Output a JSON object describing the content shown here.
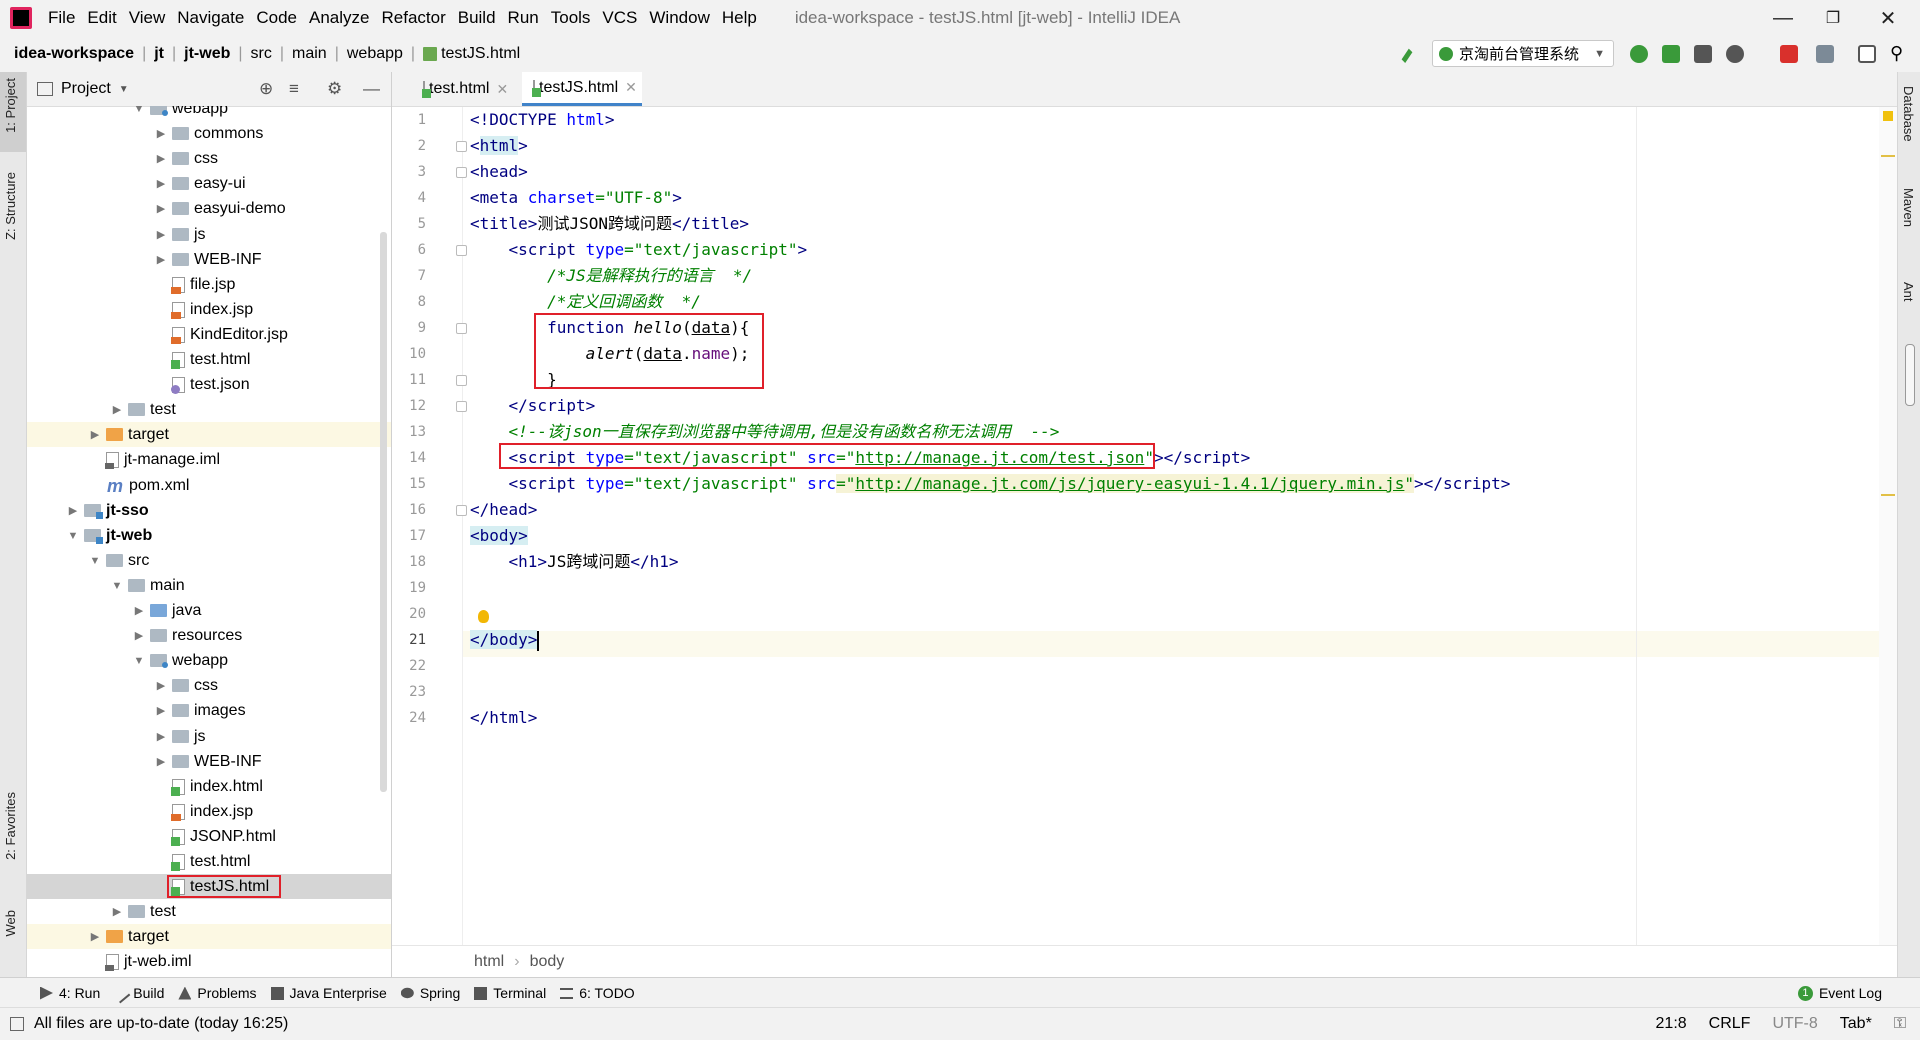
{
  "menubar": {
    "items": [
      "File",
      "Edit",
      "View",
      "Navigate",
      "Code",
      "Analyze",
      "Refactor",
      "Build",
      "Run",
      "Tools",
      "VCS",
      "Window",
      "Help"
    ],
    "window_title": "idea-workspace - testJS.html [jt-web] - IntelliJ IDEA"
  },
  "navbar": {
    "crumbs": [
      "idea-workspace",
      "jt",
      "jt-web",
      "src",
      "main",
      "webapp",
      "testJS.html"
    ],
    "run_config": "京淘前台管理系统"
  },
  "left_stripe": {
    "project": "1: Project",
    "structure": "Z: Structure",
    "favorites": "2: Favorites",
    "web": "Web"
  },
  "right_stripe": {
    "database": "Database",
    "maven": "Maven",
    "ant": "Ant"
  },
  "project_panel": {
    "title": "Project",
    "tree": [
      {
        "label": "webapp",
        "indent": 1,
        "arrow": "down",
        "icon": "folder-web"
      },
      {
        "label": "commons",
        "indent": 2,
        "arrow": "right",
        "icon": "folder"
      },
      {
        "label": "css",
        "indent": 2,
        "arrow": "right",
        "icon": "folder"
      },
      {
        "label": "easy-ui",
        "indent": 2,
        "arrow": "right",
        "icon": "folder"
      },
      {
        "label": "easyui-demo",
        "indent": 2,
        "arrow": "right",
        "icon": "folder"
      },
      {
        "label": "js",
        "indent": 2,
        "arrow": "right",
        "icon": "folder"
      },
      {
        "label": "WEB-INF",
        "indent": 2,
        "arrow": "right",
        "icon": "folder"
      },
      {
        "label": "file.jsp",
        "indent": 2,
        "arrow": "",
        "icon": "jsp"
      },
      {
        "label": "index.jsp",
        "indent": 2,
        "arrow": "",
        "icon": "jsp"
      },
      {
        "label": "KindEditor.jsp",
        "indent": 2,
        "arrow": "",
        "icon": "jsp"
      },
      {
        "label": "test.html",
        "indent": 2,
        "arrow": "",
        "icon": "html"
      },
      {
        "label": "test.json",
        "indent": 2,
        "arrow": "",
        "icon": "json"
      },
      {
        "label": "test",
        "indent": 0,
        "arrow": "right",
        "icon": "folder"
      },
      {
        "label": "target",
        "indent": -1,
        "arrow": "right",
        "icon": "folder-orange",
        "row": "yellow"
      },
      {
        "label": "jt-manage.iml",
        "indent": -1,
        "arrow": "",
        "icon": "iml"
      },
      {
        "label": "pom.xml",
        "indent": -1,
        "arrow": "",
        "icon": "pom"
      },
      {
        "label": "jt-sso",
        "indent": -2,
        "arrow": "right",
        "icon": "module",
        "bold": true
      },
      {
        "label": "jt-web",
        "indent": -2,
        "arrow": "down",
        "icon": "module",
        "bold": true
      },
      {
        "label": "src",
        "indent": -1,
        "arrow": "down",
        "icon": "folder"
      },
      {
        "label": "main",
        "indent": 0,
        "arrow": "down",
        "icon": "folder"
      },
      {
        "label": "java",
        "indent": 1,
        "arrow": "right",
        "icon": "folder-blue"
      },
      {
        "label": "resources",
        "indent": 1,
        "arrow": "right",
        "icon": "folder"
      },
      {
        "label": "webapp",
        "indent": 1,
        "arrow": "down",
        "icon": "folder-web"
      },
      {
        "label": "css",
        "indent": 2,
        "arrow": "right",
        "icon": "folder"
      },
      {
        "label": "images",
        "indent": 2,
        "arrow": "right",
        "icon": "folder"
      },
      {
        "label": "js",
        "indent": 2,
        "arrow": "right",
        "icon": "folder"
      },
      {
        "label": "WEB-INF",
        "indent": 2,
        "arrow": "right",
        "icon": "folder"
      },
      {
        "label": "index.html",
        "indent": 2,
        "arrow": "",
        "icon": "html"
      },
      {
        "label": "index.jsp",
        "indent": 2,
        "arrow": "",
        "icon": "jsp"
      },
      {
        "label": "JSONP.html",
        "indent": 2,
        "arrow": "",
        "icon": "html"
      },
      {
        "label": "test.html",
        "indent": 2,
        "arrow": "",
        "icon": "html"
      },
      {
        "label": "testJS.html",
        "indent": 2,
        "arrow": "",
        "icon": "html",
        "row": "selected"
      },
      {
        "label": "test",
        "indent": 0,
        "arrow": "right",
        "icon": "folder"
      },
      {
        "label": "target",
        "indent": -1,
        "arrow": "right",
        "icon": "folder-orange",
        "row": "yellow"
      },
      {
        "label": "jt-web.iml",
        "indent": -1,
        "arrow": "",
        "icon": "iml"
      }
    ]
  },
  "tabs": [
    {
      "label": "test.html",
      "active": false
    },
    {
      "label": "testJS.html",
      "active": true
    }
  ],
  "code_line_numbers": [
    "1",
    "2",
    "3",
    "4",
    "5",
    "6",
    "7",
    "8",
    "9",
    "10",
    "11",
    "12",
    "13",
    "14",
    "15",
    "16",
    "17",
    "18",
    "19",
    "20",
    "21",
    "22",
    "23",
    "24"
  ],
  "editor_breadcrumb": [
    "html",
    "body"
  ],
  "toolwindows": {
    "run": "4: Run",
    "build": "Build",
    "problems": "Problems",
    "java_enterprise": "Java Enterprise",
    "spring": "Spring",
    "terminal": "Terminal",
    "todo": "6: TODO",
    "event_log": "Event Log",
    "event_log_count": "1"
  },
  "status": {
    "message": "All files are up-to-date (today 16:25)",
    "position": "21:8",
    "line_sep": "CRLF",
    "encoding": "UTF-8",
    "indent": "Tab*"
  },
  "colors": {
    "accent": "#4083c9",
    "highlight_box": "#e0202a",
    "tag": "#000080",
    "attr_value": "#008000"
  }
}
